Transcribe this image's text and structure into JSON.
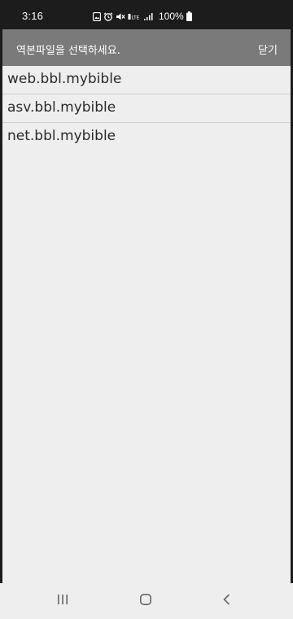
{
  "status_bar": {
    "time": "3:16",
    "battery_percent": "100%",
    "icons": [
      "photo-icon",
      "alarm-icon",
      "mute-icon",
      "volte-icon",
      "signal-icon",
      "battery-icon"
    ]
  },
  "dialog": {
    "title": "역본파일을 선택하세요.",
    "close_label": "닫기",
    "files": [
      {
        "name": "web.bbl.mybible"
      },
      {
        "name": "asv.bbl.mybible"
      },
      {
        "name": "net.bbl.mybible"
      }
    ]
  },
  "nav_bar": {
    "buttons": [
      "recents-icon",
      "home-icon",
      "back-icon"
    ]
  },
  "colors": {
    "header_bg": "#7a7a7a",
    "dialog_bg": "#eeeeee",
    "status_bg": "#1c1c1c"
  }
}
